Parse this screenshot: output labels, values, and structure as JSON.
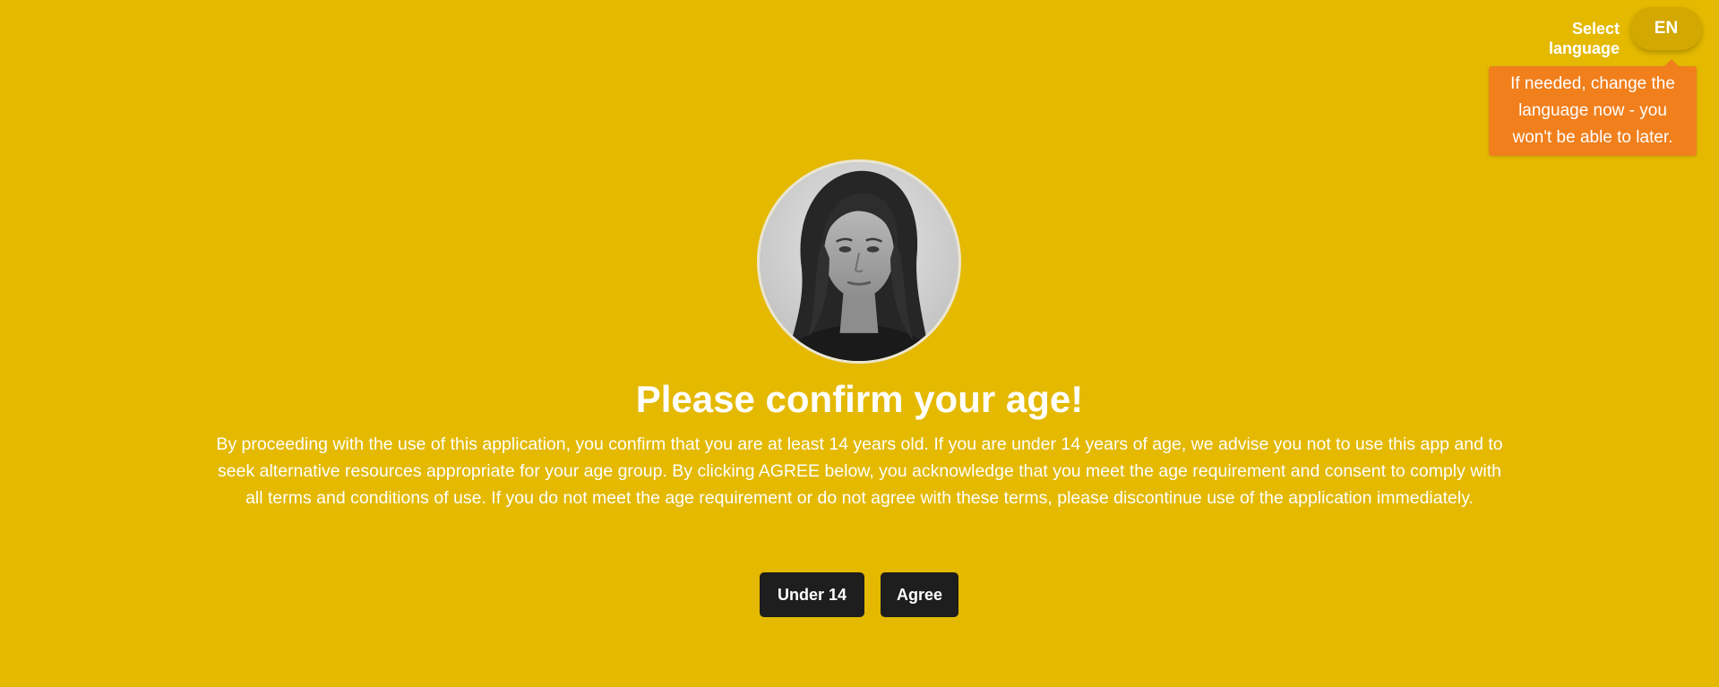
{
  "language": {
    "label": "Select language",
    "current": "EN",
    "tooltip": "If needed, change the language now - you won't be able to later."
  },
  "avatar": {
    "icon": "portrait-avatar"
  },
  "consent": {
    "title": "Please confirm your age!",
    "body": "By proceeding with the use of this application, you confirm that you are at least 14 years old. If you are under 14 years of age, we advise you not to use this app and to seek alternative resources appropriate for your age group. By clicking AGREE below, you acknowledge that you meet the age requirement and consent to comply with all terms and conditions of use. If you do not meet the age requirement or do not agree with these terms, please discontinue use of the application immediately."
  },
  "buttons": {
    "under14": "Under 14",
    "agree": "Agree"
  },
  "colors": {
    "background": "#E4B900",
    "language_button": "#D3A800",
    "tooltip": "#F07F1C",
    "action_button": "#1E1E1E"
  }
}
